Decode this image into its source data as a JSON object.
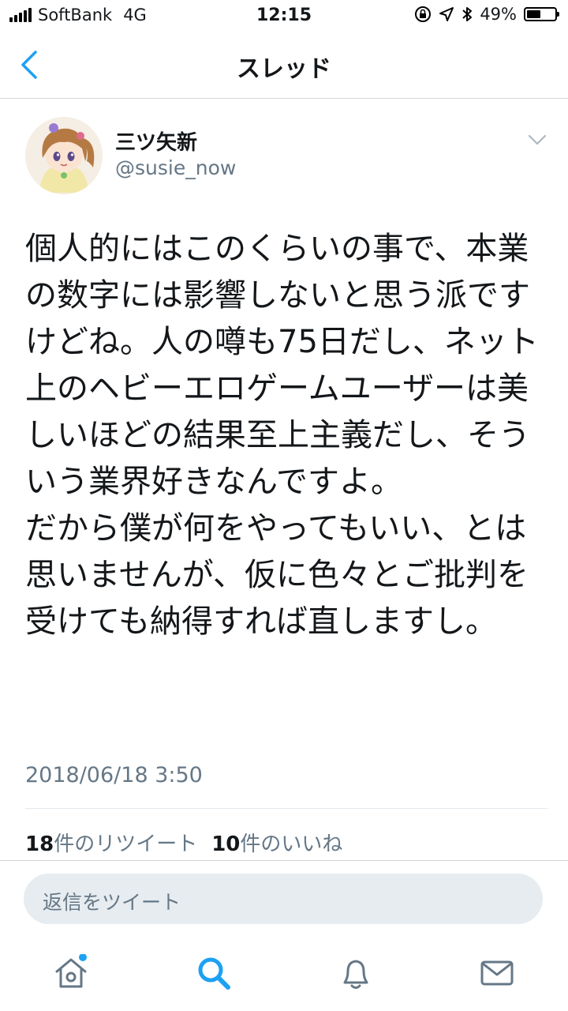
{
  "status_bar": {
    "carrier": "SoftBank",
    "network": "4G",
    "time": "12:15",
    "battery": "49%",
    "battery_level": 0.49
  },
  "nav": {
    "title": "スレッド"
  },
  "tweet": {
    "display_name": "三ツ矢新",
    "handle": "@susie_now",
    "text": "個人的にはこのくらいの事で、本業の数字には影響しないと思う派ですけどね。人の噂も75日だし、ネット上のヘビーエロゲームユーザーは美しいほどの結果至上主義だし、そういう業界好きなんですよ。\nだから僕が何をやってもいい、とは思いませんが、仮に色々とご批判を受けても納得すれば直しますし。",
    "timestamp": "2018/06/18 3:50",
    "retweet_count": "18",
    "retweet_label": "件のリツイート",
    "like_count": "10",
    "like_label": "件のいいね"
  },
  "reply": {
    "placeholder": "返信をツイート"
  },
  "tabs": [
    {
      "icon": "home-icon"
    },
    {
      "icon": "search-icon"
    },
    {
      "icon": "bell-icon"
    },
    {
      "icon": "mail-icon"
    }
  ],
  "colors": {
    "accent": "#1da1f2",
    "muted": "#657786",
    "icon_gray": "#657786",
    "reply_bg": "#e6ecf0"
  }
}
